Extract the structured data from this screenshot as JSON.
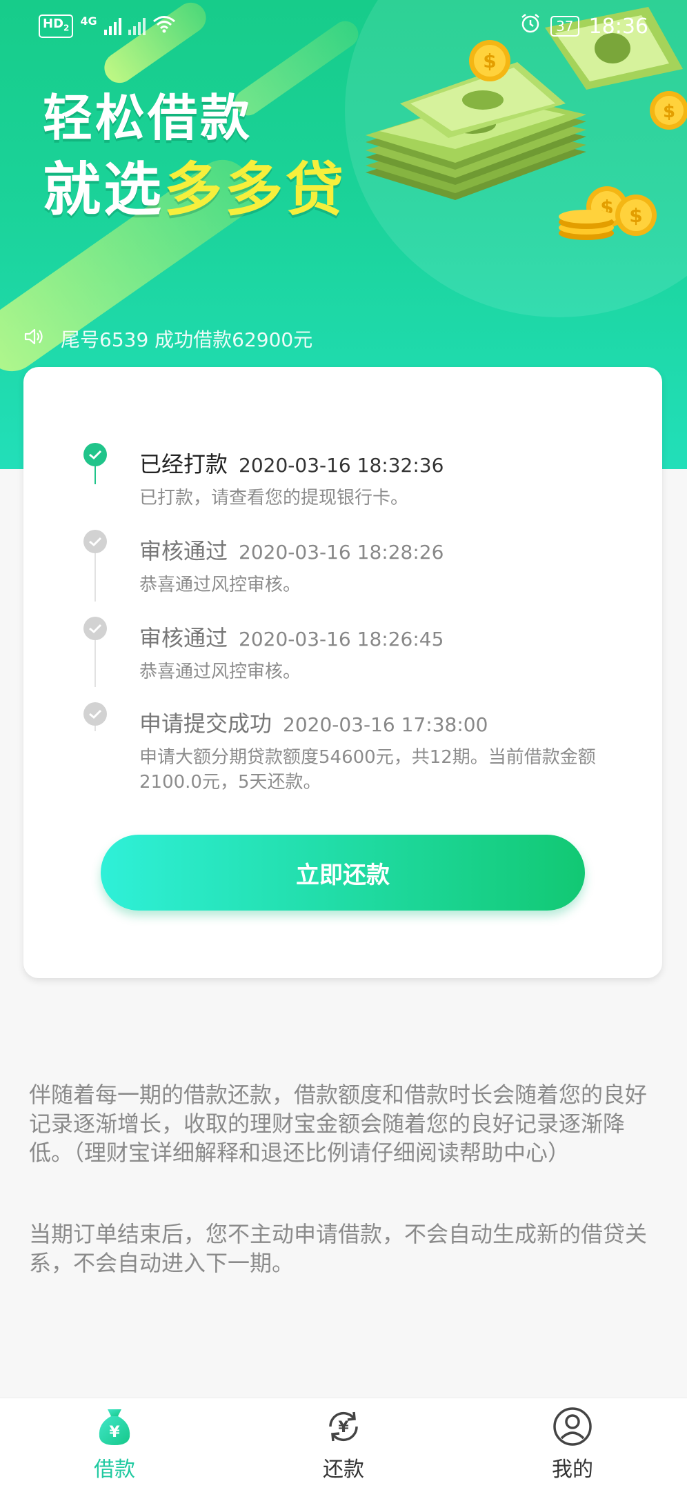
{
  "status_bar": {
    "network_badge": "HD",
    "network_badge_sub": "2",
    "network_type": "4G",
    "battery": "37",
    "time": "18:36"
  },
  "hero": {
    "slogan_line1": "轻松借款",
    "slogan_line2_prefix": "就选",
    "slogan_line2_brand": "多多贷",
    "brand_color": "#f6ef3c",
    "notice": "尾号6539 成功借款62900元"
  },
  "timeline": [
    {
      "title": "已经打款",
      "time": "2020-03-16 18:32:36",
      "desc": "已打款，请查看您的提现银行卡。",
      "active": true
    },
    {
      "title": "审核通过",
      "time": "2020-03-16 18:28:26",
      "desc": "恭喜通过风控审核。",
      "active": false
    },
    {
      "title": "审核通过",
      "time": "2020-03-16 18:26:45",
      "desc": "恭喜通过风控审核。",
      "active": false
    },
    {
      "title": "申请提交成功",
      "time": "2020-03-16 17:38:00",
      "desc": "申请大额分期贷款额度54600元，共12期。当前借款金额2100.0元，5天还款。",
      "active": false
    }
  ],
  "repay_button": "立即还款",
  "info": {
    "paragraph1": "伴随着每一期的借款还款，借款额度和借款时长会随着您的良好记录逐渐增长，收取的理财宝金额会随着您的良好记录逐渐降低。（理财宝详细解释和退还比例请仔细阅读帮助中心）",
    "paragraph2": "当期订单结束后，您不主动申请借款，不会自动生成新的借贷关系，不会自动进入下一期。"
  },
  "bottom_nav": [
    {
      "label": "借款",
      "icon": "money-bag-icon",
      "active": true
    },
    {
      "label": "还款",
      "icon": "yuan-cycle-icon",
      "active": false
    },
    {
      "label": "我的",
      "icon": "user-circle-icon",
      "active": false
    }
  ],
  "colors": {
    "primary_green": "#20c48a",
    "nav_active": "#1fc9a0",
    "button_gradient_start": "#2ff0d8",
    "button_gradient_end": "#12c873"
  }
}
